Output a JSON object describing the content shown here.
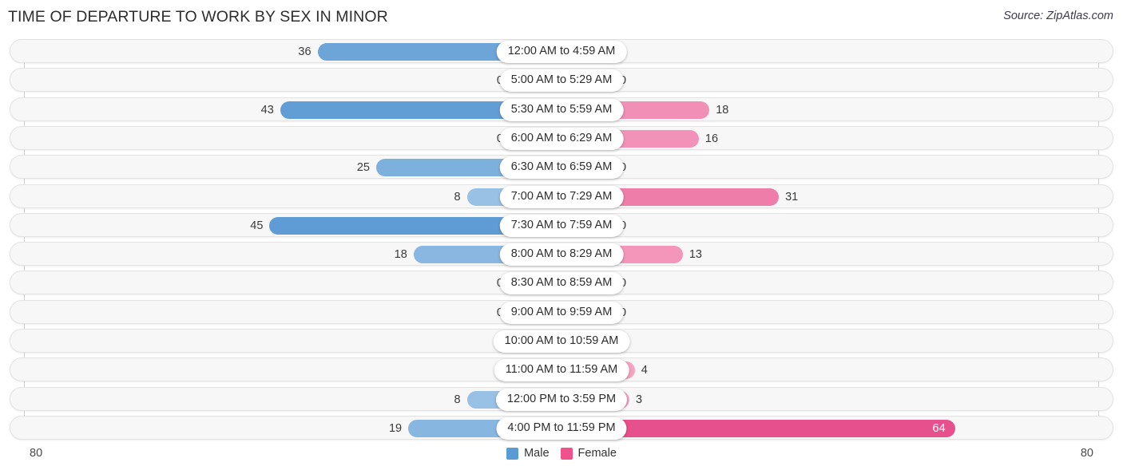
{
  "header": {
    "title": "TIME OF DEPARTURE TO WORK BY SEX IN MINOR",
    "source": "Source: ZipAtlas.com"
  },
  "legend": {
    "items": [
      {
        "label": "Male",
        "color": "#5b9bd5"
      },
      {
        "label": "Female",
        "color": "#f0508c"
      }
    ]
  },
  "axis": {
    "left_tick": "80",
    "right_tick": "80"
  },
  "chart_data": {
    "type": "bar",
    "title": "TIME OF DEPARTURE TO WORK BY SEX IN MINOR",
    "subtitle": "",
    "xlabel": "",
    "ylabel": "",
    "orientation": "horizontal-diverging",
    "axis_max": 80,
    "xlim": [
      80,
      80
    ],
    "grid": false,
    "legend_position": "bottom-center",
    "categories": [
      "12:00 AM to 4:59 AM",
      "5:00 AM to 5:29 AM",
      "5:30 AM to 5:59 AM",
      "6:00 AM to 6:29 AM",
      "6:30 AM to 6:59 AM",
      "7:00 AM to 7:29 AM",
      "7:30 AM to 7:59 AM",
      "8:00 AM to 8:29 AM",
      "8:30 AM to 8:59 AM",
      "9:00 AM to 9:59 AM",
      "10:00 AM to 10:59 AM",
      "11:00 AM to 11:59 AM",
      "12:00 PM to 3:59 PM",
      "4:00 PM to 11:59 PM"
    ],
    "series": [
      {
        "name": "Male",
        "color": "#5b9bd5",
        "values": [
          36,
          0,
          43,
          0,
          25,
          8,
          45,
          18,
          0,
          0,
          0,
          0,
          8,
          19
        ]
      },
      {
        "name": "Female",
        "color": "#f0508c",
        "values": [
          0,
          0,
          18,
          16,
          0,
          31,
          0,
          13,
          0,
          0,
          0,
          4,
          3,
          64
        ]
      }
    ]
  },
  "rows": [
    {
      "label": "12:00 AM to 4:59 AM",
      "male": "36",
      "female": "0"
    },
    {
      "label": "5:00 AM to 5:29 AM",
      "male": "0",
      "female": "0"
    },
    {
      "label": "5:30 AM to 5:59 AM",
      "male": "43",
      "female": "18"
    },
    {
      "label": "6:00 AM to 6:29 AM",
      "male": "0",
      "female": "16"
    },
    {
      "label": "6:30 AM to 6:59 AM",
      "male": "25",
      "female": "0"
    },
    {
      "label": "7:00 AM to 7:29 AM",
      "male": "8",
      "female": "31"
    },
    {
      "label": "7:30 AM to 7:59 AM",
      "male": "45",
      "female": "0"
    },
    {
      "label": "8:00 AM to 8:29 AM",
      "male": "18",
      "female": "13"
    },
    {
      "label": "8:30 AM to 8:59 AM",
      "male": "0",
      "female": "0"
    },
    {
      "label": "9:00 AM to 9:59 AM",
      "male": "0",
      "female": "0"
    },
    {
      "label": "10:00 AM to 10:59 AM",
      "male": "0",
      "female": "0"
    },
    {
      "label": "11:00 AM to 11:59 AM",
      "male": "0",
      "female": "4"
    },
    {
      "label": "12:00 PM to 3:59 PM",
      "male": "8",
      "female": "3"
    },
    {
      "label": "4:00 PM to 11:59 PM",
      "male": "19",
      "female": "64"
    }
  ]
}
